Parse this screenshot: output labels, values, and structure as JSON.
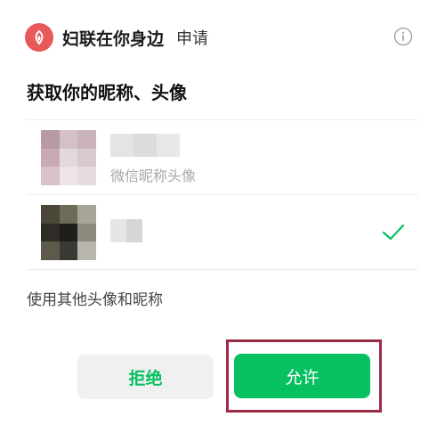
{
  "header": {
    "app_name": "妇联在你身边",
    "apply_text": "申请",
    "logo_icon": "flower-logo-icon",
    "info_icon": "info-icon"
  },
  "title": "获取你的昵称、头像",
  "accounts": [
    {
      "sub_label": "微信昵称头像",
      "selected": false
    },
    {
      "sub_label": "",
      "selected": true,
      "check_icon": "checkmark-icon"
    }
  ],
  "other_option": "使用其他头像和昵称",
  "buttons": {
    "deny_label": "拒绝",
    "allow_label": "允许"
  },
  "colors": {
    "accent": "#07c160",
    "logo": "#e8595a",
    "highlight": "#9b2a45"
  }
}
